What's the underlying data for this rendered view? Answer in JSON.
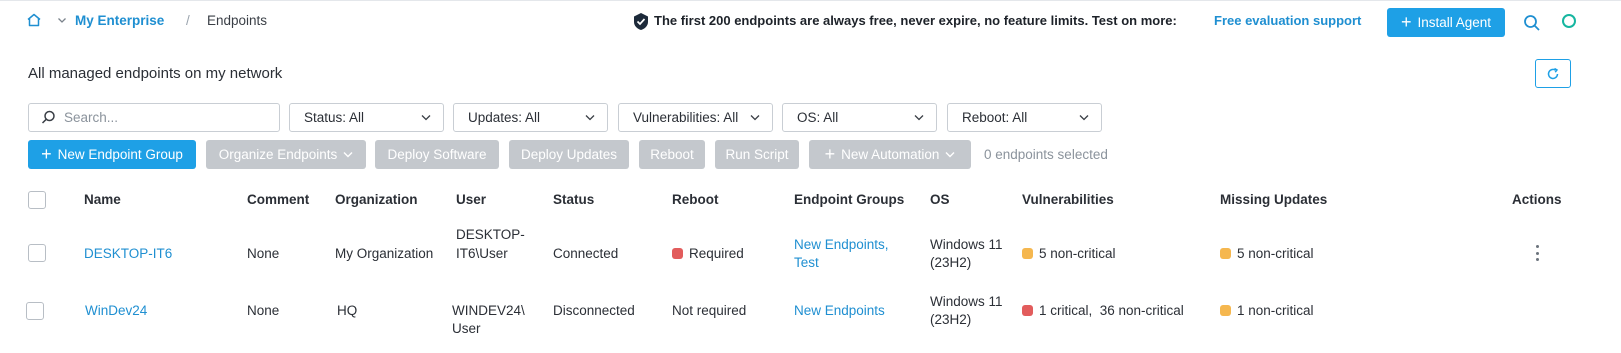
{
  "breadcrumb": {
    "enterprise": "My Enterprise",
    "separator": "/",
    "current": "Endpoints"
  },
  "promo": {
    "text": "The first 200 endpoints are always free, never expire, no feature limits. Test on more:",
    "link": "Free evaluation support"
  },
  "header": {
    "install_label": "Install Agent"
  },
  "page": {
    "title": "All managed endpoints on my network"
  },
  "filters": {
    "search_placeholder": "Search...",
    "status": "Status: All",
    "updates": "Updates: All",
    "vulnerabilities": "Vulnerabilities: All",
    "os": "OS: All",
    "reboot": "Reboot: All"
  },
  "actions": {
    "new_group": "New Endpoint Group",
    "organize": "Organize Endpoints",
    "deploy_software": "Deploy Software",
    "deploy_updates": "Deploy Updates",
    "reboot": "Reboot",
    "run_script": "Run Script",
    "new_automation": "New Automation",
    "selected": "0 endpoints selected"
  },
  "table": {
    "columns": [
      "Name",
      "Comment",
      "Organization",
      "User",
      "Status",
      "Reboot",
      "Endpoint Groups",
      "OS",
      "Vulnerabilities",
      "Missing Updates",
      "Actions"
    ],
    "rows": [
      {
        "name": "DESKTOP-IT6",
        "comment": "None",
        "organization": "My Organization",
        "user_line1": "DESKTOP-",
        "user_line2": "IT6\\User",
        "status": "Connected",
        "reboot": "Required",
        "groups_line1": "New Endpoints,",
        "groups_line2": "Test",
        "os_line1": "Windows 11",
        "os_line2": "(23H2)",
        "vulnerabilities": "5 non-critical",
        "missing_updates": "5 non-critical"
      },
      {
        "name": "WinDev24",
        "comment": "None",
        "organization": "HQ",
        "user_line1": "WINDEV24\\",
        "user_line2": "User",
        "status": "Disconnected",
        "reboot": "Not required",
        "groups_line1": "New Endpoints",
        "os_line1": "Windows 11",
        "os_line2": "(23H2)",
        "vulnerabilities": "1 critical,  36 non-critical",
        "missing_updates": "1 non-critical"
      }
    ]
  },
  "colors": {
    "accent": "#1ea0e6",
    "link": "#1f8fd1",
    "critical": "#e25c5c",
    "noncritical": "#f5b74f",
    "disabled": "#c4c8cd"
  }
}
